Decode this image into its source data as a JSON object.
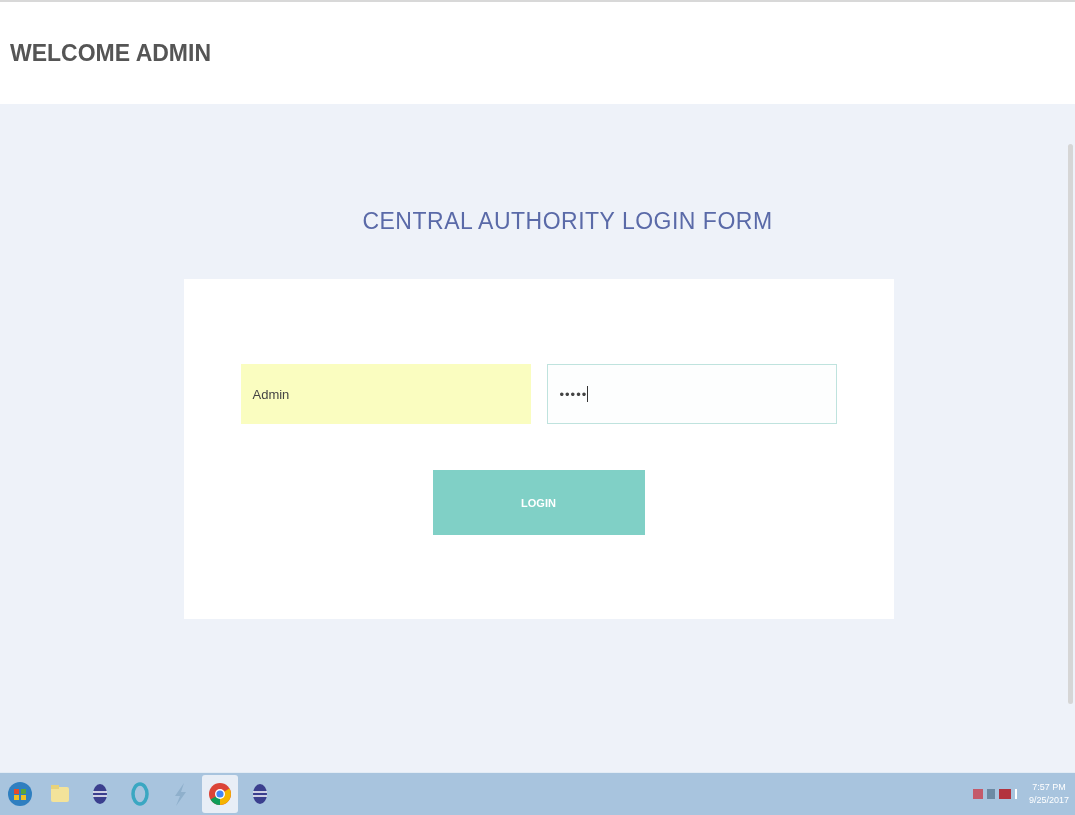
{
  "header": {
    "title": "WELCOME ADMIN"
  },
  "form": {
    "title": "CENTRAL AUTHORITY LOGIN FORM",
    "fields": [
      {
        "kind": "text",
        "value": "Admin",
        "autofilled": true
      },
      {
        "kind": "password",
        "value": "•••••",
        "autofilled": false
      }
    ],
    "button": "LOGIN"
  },
  "taskbar": {
    "apps": [
      {
        "kind": "start"
      },
      {
        "kind": "folder"
      },
      {
        "kind": "eclipse"
      },
      {
        "kind": "ring"
      },
      {
        "kind": "bolt"
      },
      {
        "kind": "chrome",
        "selected": true
      },
      {
        "kind": "eclipse",
        "selected": false
      }
    ],
    "clock": {
      "time": "7:57 PM",
      "date": "9/25/2017"
    }
  }
}
